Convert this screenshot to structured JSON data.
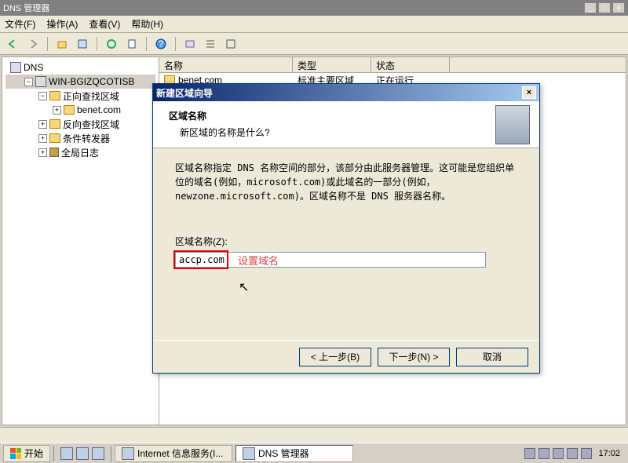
{
  "window": {
    "title": "DNS 管理器"
  },
  "menu": {
    "file": "文件(F)",
    "action": "操作(A)",
    "view": "查看(V)",
    "help": "帮助(H)"
  },
  "tree": {
    "root": "DNS",
    "server": "WIN-BGIZQCOTISB",
    "forward": "正向查找区域",
    "zone1": "benet.com",
    "reverse": "反向查找区域",
    "forwarders": "条件转发器",
    "logs": "全局日志"
  },
  "list": {
    "col_name": "名称",
    "col_type": "类型",
    "col_status": "状态",
    "row1_name": "benet.com",
    "row1_type": "标准主要区域",
    "row1_status": "正在运行"
  },
  "dialog": {
    "title": "新建区域向导",
    "header_title": "区域名称",
    "header_sub": "新区域的名称是什么?",
    "body_text": "区域名称指定 DNS 名称空间的部分，该部分由此服务器管理。这可能是您组织单位的域名(例如，microsoft.com)或此域名的一部分(例如，newzone.microsoft.com)。区域名称不是 DNS 服务器名称。",
    "field_label": "区域名称(Z):",
    "input_value": "accp.com",
    "annotation": "设置域名",
    "btn_back": "< 上一步(B)",
    "btn_next": "下一步(N) >",
    "btn_cancel": "取消"
  },
  "taskbar": {
    "start": "开始",
    "task1": "Internet 信息服务(I...",
    "task2": "DNS 管理器",
    "time": "17:02"
  }
}
